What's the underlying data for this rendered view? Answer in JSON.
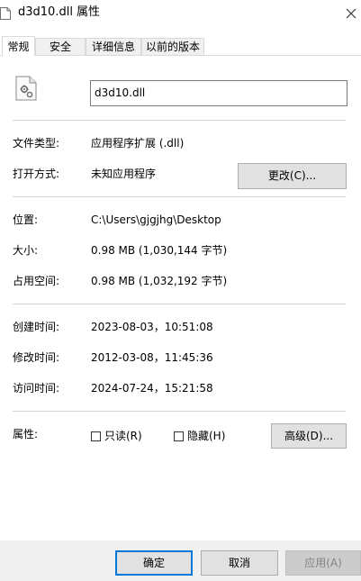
{
  "window": {
    "title": "d3d10.dll 属性",
    "close_icon": "close-icon"
  },
  "tabs": [
    {
      "label": "常规"
    },
    {
      "label": "安全"
    },
    {
      "label": "详细信息"
    },
    {
      "label": "以前的版本"
    }
  ],
  "general": {
    "file_name": "d3d10.dll",
    "file_icon": "dll-file-gear-icon",
    "file_type_label": "文件类型:",
    "file_type_value": "应用程序扩展 (.dll)",
    "open_with_label": "打开方式:",
    "open_with_value": "未知应用程序",
    "change_button": "更改(C)...",
    "location_label": "位置:",
    "location_value": "C:\\Users\\gjgjhg\\Desktop",
    "size_label": "大小:",
    "size_value": "0.98 MB (1,030,144 字节)",
    "size_on_disk_label": "占用空间:",
    "size_on_disk_value": "0.98 MB (1,032,192 字节)",
    "created_label": "创建时间:",
    "created_value": "2023-08-03，10:51:08",
    "modified_label": "修改时间:",
    "modified_value": "2012-03-08，11:45:36",
    "accessed_label": "访问时间:",
    "accessed_value": "2024-07-24，15:21:58",
    "attributes_label": "属性:",
    "readonly_label": "只读(R)",
    "readonly_checked": false,
    "hidden_label": "隐藏(H)",
    "hidden_checked": false,
    "advanced_button": "高级(D)..."
  },
  "footer": {
    "ok": "确定",
    "cancel": "取消",
    "apply": "应用(A)"
  },
  "colors": {
    "primary_border": "#0078d7",
    "button_bg": "#e1e1e1",
    "footer_bg": "#f0f0f0"
  }
}
